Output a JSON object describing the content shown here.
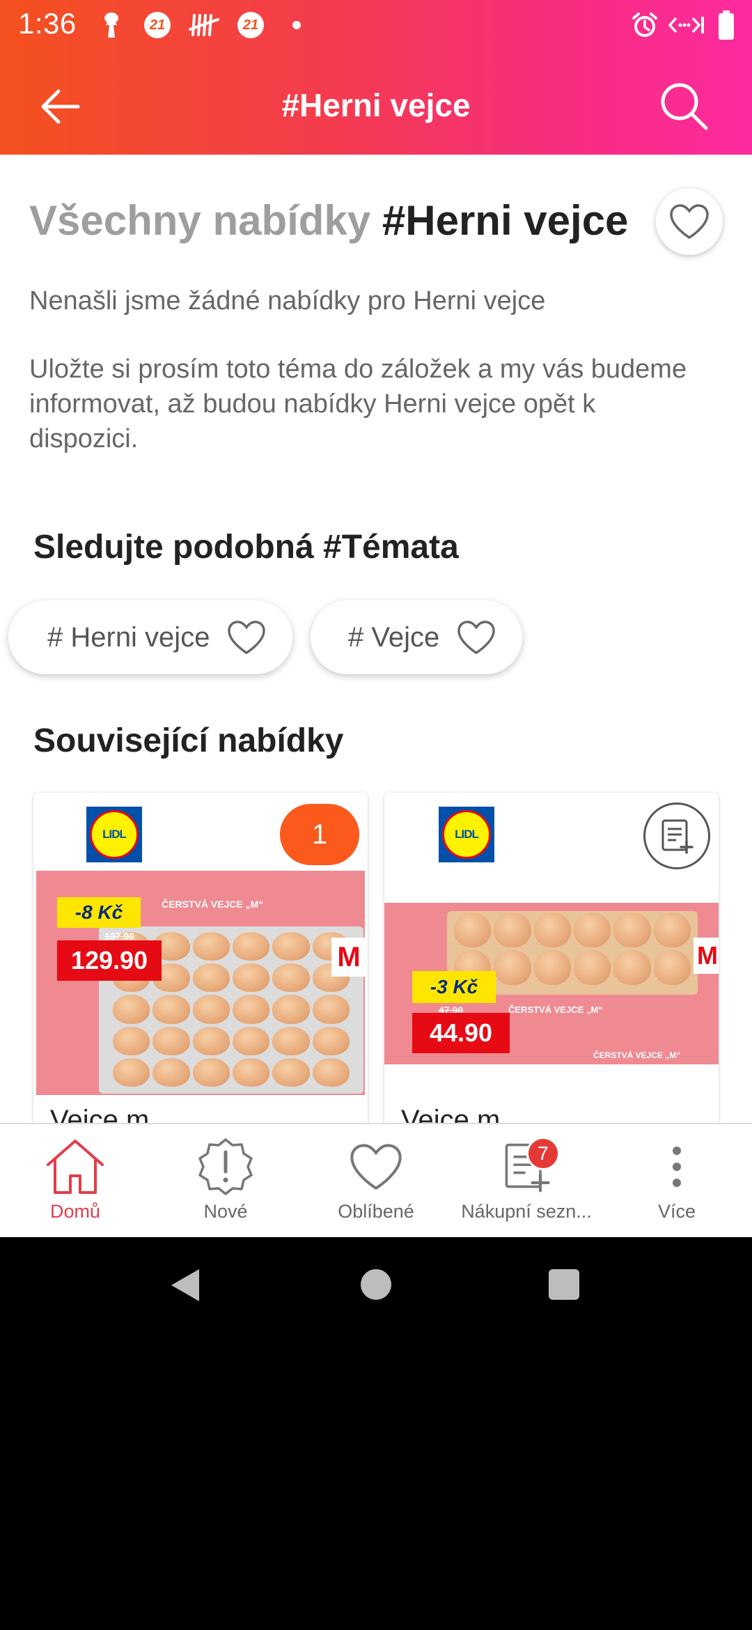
{
  "status_bar": {
    "time": "1:36",
    "badge1": "21",
    "badge2": "21"
  },
  "app_bar": {
    "title": "#Herni vejce"
  },
  "page": {
    "heading_prefix": "Všechny nabídky",
    "heading_topic": "#Herni vejce",
    "not_found": "Nenašli jsme žádné nabídky pro Herni vejce",
    "bookmark_hint": "Uložte si prosím toto téma do záložek a my vás budeme informovat, až budou nabídky Herni vejce opět k dispozici."
  },
  "similar_topics": {
    "title": "Sledujte podobná #Témata",
    "chips": [
      {
        "label": "# Herni vejce"
      },
      {
        "label": "# Vejce"
      }
    ]
  },
  "related_offers": {
    "title": "Související nabídky",
    "cards": [
      {
        "store": "LIDL",
        "count": "1",
        "discount": "-8 Kč",
        "old_price": "137.90",
        "price": "129.90",
        "product_line": "ČERSTVÁ VEJCE „M“",
        "size": "M",
        "title": "Vejce m"
      },
      {
        "store": "LIDL",
        "discount": "-3 Kč",
        "old_price": "47.90",
        "price": "44.90",
        "product_line": "ČERSTVÁ VEJCE „M“",
        "product_line2": "ČERSTVÁ VEJCE „M“",
        "size": "M",
        "title": "Vejce m"
      }
    ]
  },
  "bottom_nav": {
    "items": [
      {
        "label": "Domů",
        "icon": "home-icon",
        "active": true
      },
      {
        "label": "Nové",
        "icon": "alert-badge-icon"
      },
      {
        "label": "Oblíbené",
        "icon": "heart-icon"
      },
      {
        "label": "Nákupní sezn...",
        "icon": "shopping-list-icon",
        "badge": "7"
      },
      {
        "label": "Více",
        "icon": "more-vertical-icon"
      }
    ]
  },
  "colors": {
    "header_gradient_start": "#f4511e",
    "header_gradient_end": "#fd2aa0",
    "accent": "#e33d4a",
    "count_pill": "#fb5a1c"
  }
}
